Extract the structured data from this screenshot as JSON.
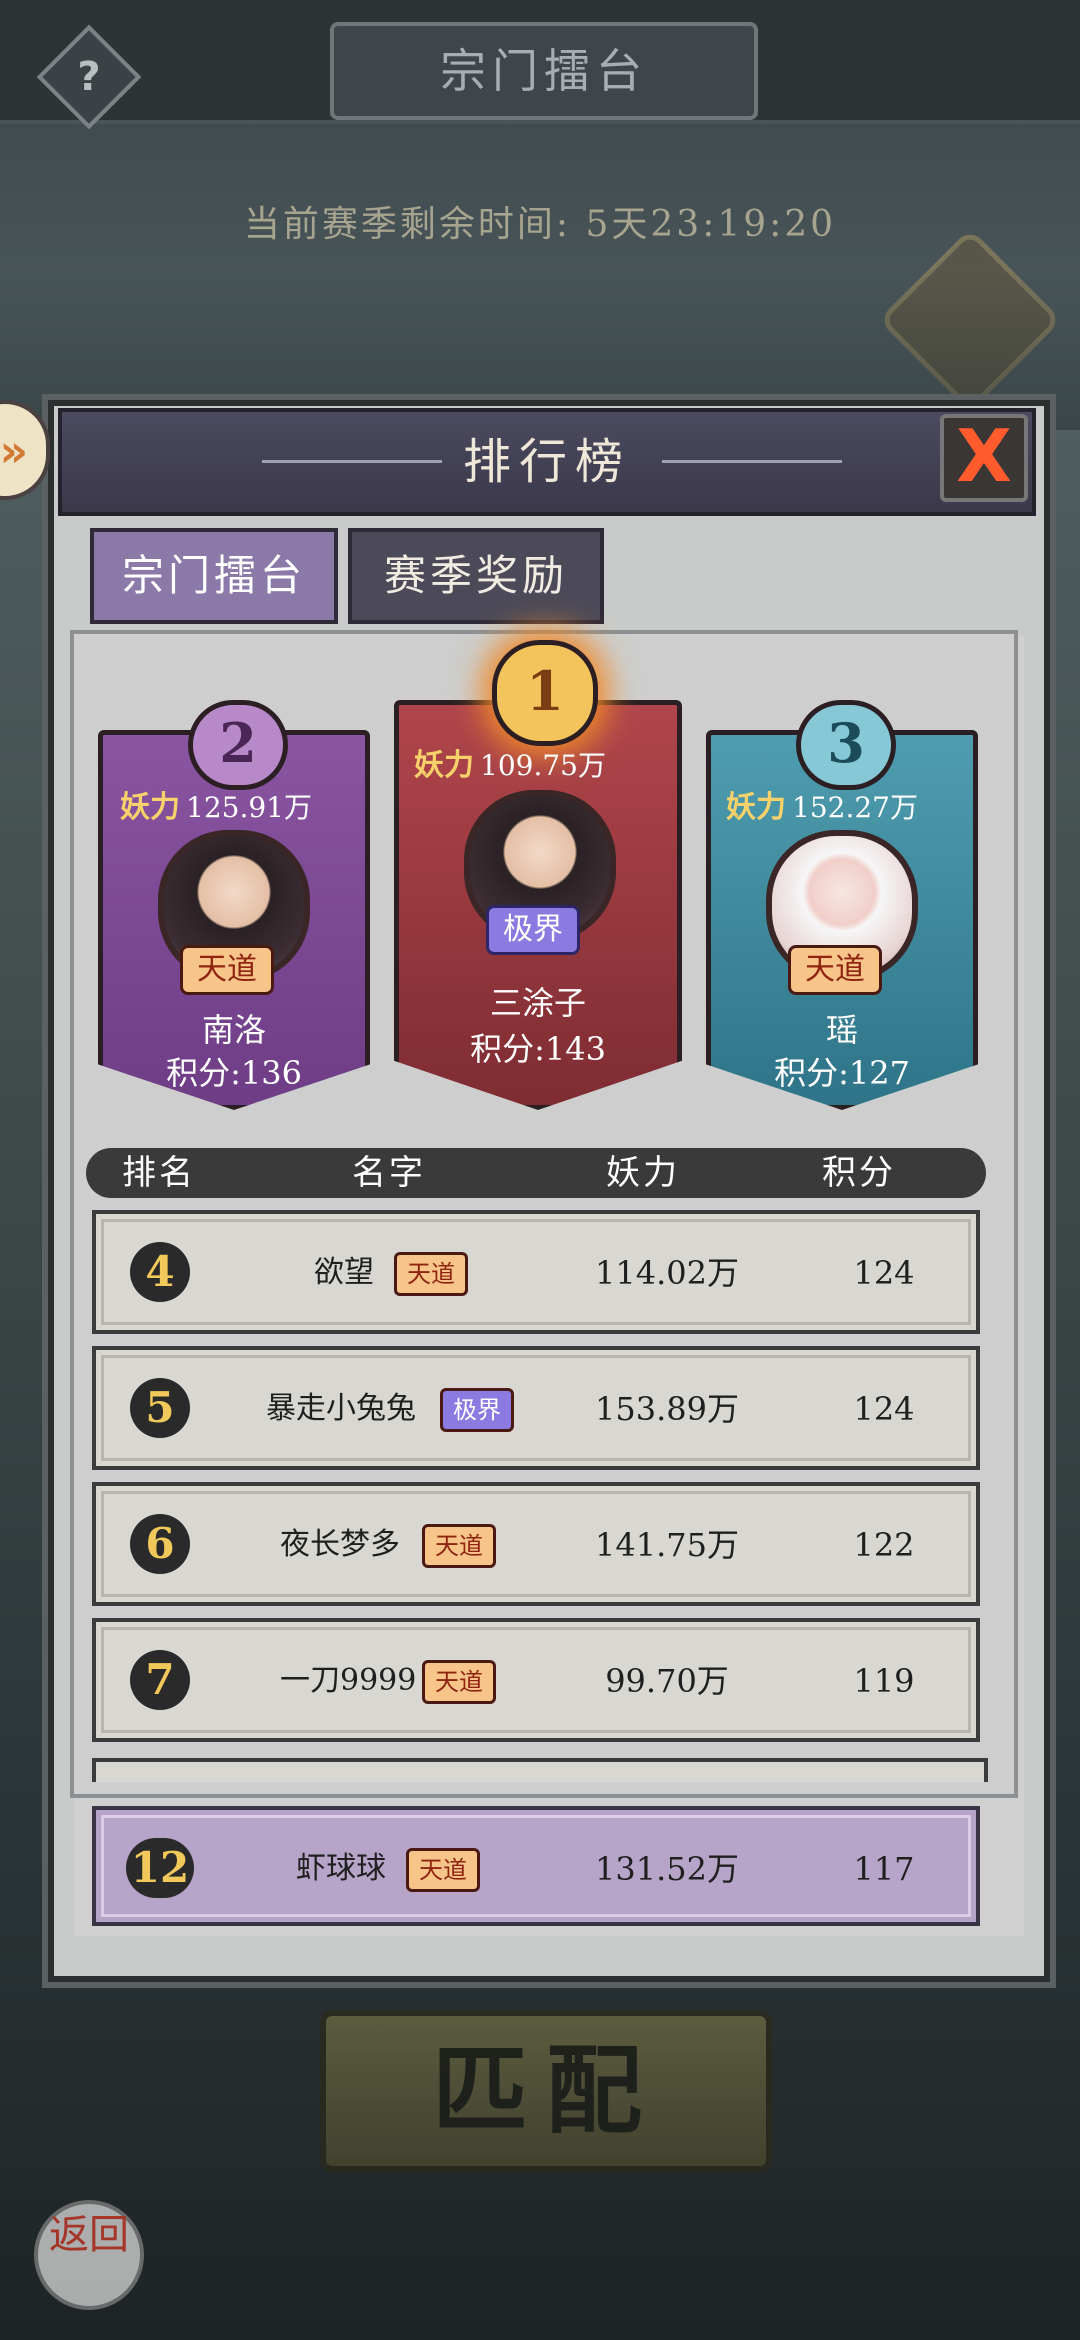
{
  "top_bar": {
    "help_label": "?",
    "title": "宗门擂台"
  },
  "timer": {
    "label": "当前赛季剩余时间:",
    "value": "5天23:19:20"
  },
  "leaderboard": {
    "title": "排行榜",
    "close_label": "X",
    "expand_label": "»",
    "tabs": [
      {
        "label": "宗门擂台",
        "active": true
      },
      {
        "label": "赛季奖励",
        "active": false
      }
    ],
    "power_label": "妖力",
    "podium": [
      {
        "rank": "1",
        "power": "109.75万",
        "name": "三涂子",
        "score_text": "积分:143",
        "badge": "极界"
      },
      {
        "rank": "2",
        "power": "125.91万",
        "name": "南洛",
        "score_text": "积分:136",
        "badge": "天道"
      },
      {
        "rank": "3",
        "power": "152.27万",
        "name": "瑶",
        "score_text": "积分:127",
        "badge": "天道"
      }
    ],
    "columns": {
      "rank": "排名",
      "name": "名字",
      "power": "妖力",
      "score": "积分"
    },
    "rows": [
      {
        "rank": "4",
        "name": "欲望",
        "badge": "天道",
        "power": "114.02万",
        "score": "124"
      },
      {
        "rank": "5",
        "name": "暴走小兔兔",
        "badge": "极界",
        "power": "153.89万",
        "score": "124"
      },
      {
        "rank": "6",
        "name": "夜长梦多",
        "badge": "天道",
        "power": "141.75万",
        "score": "122"
      },
      {
        "rank": "7",
        "name": "一刀9999",
        "badge": "天道",
        "power": "99.70万",
        "score": "119"
      }
    ],
    "self_row": {
      "rank": "12",
      "name": "虾球球",
      "badge": "天道",
      "power": "131.52万",
      "score": "117"
    }
  },
  "bottom": {
    "match_label": "匹配",
    "back_label": "返回"
  },
  "colors": {
    "accent_gold": "#f7d26a",
    "rank2_purple": "#8a55a1",
    "rank1_red": "#b0464c",
    "rank3_teal": "#4f9db0",
    "self_row": "#b7a5c9"
  }
}
